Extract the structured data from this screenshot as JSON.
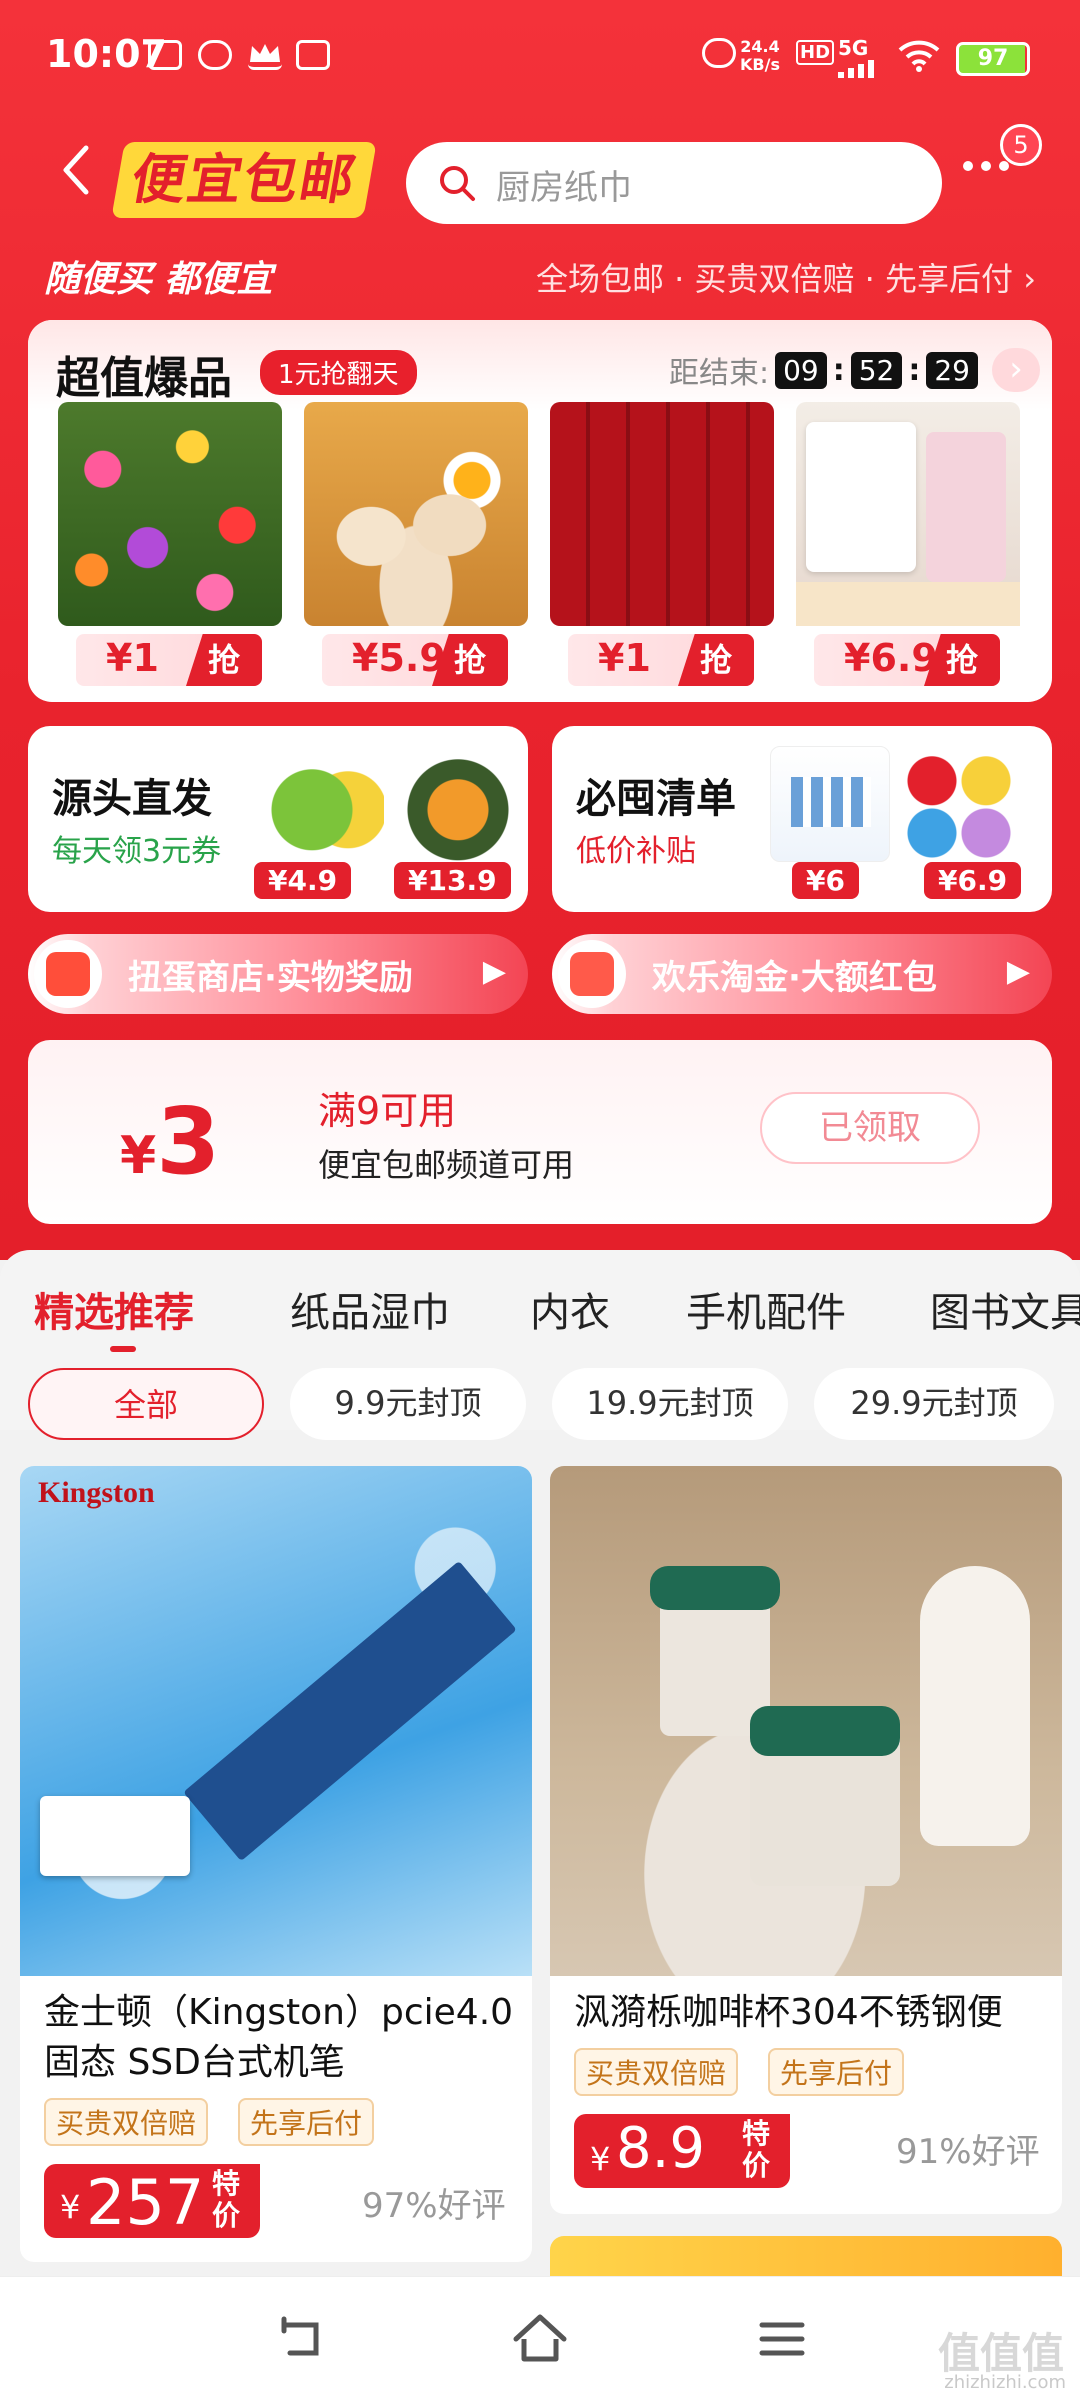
{
  "status": {
    "time": "10:07",
    "net_speed": "24.4",
    "net_unit": "KB/s",
    "hd": "HD",
    "signal": "5G",
    "battery": "97"
  },
  "header": {
    "brand": "便宜包邮",
    "search_placeholder": "厨房纸巾",
    "notif_count": "5"
  },
  "slogan": "随便买 都便宜",
  "benefits": "全场包邮 · 买贵双倍赔 · 先享后付",
  "hot": {
    "title": "超值爆品",
    "tag": "1元抢翻天",
    "countdown_label": "距结束:",
    "h": "09",
    "m": "52",
    "s": "29",
    "items": [
      {
        "price": "¥1",
        "btn": "抢"
      },
      {
        "price": "¥5.9",
        "btn": "抢"
      },
      {
        "price": "¥1",
        "btn": "抢"
      },
      {
        "price": "¥6.9",
        "btn": "抢"
      }
    ]
  },
  "promo": {
    "left": {
      "title": "源头直发",
      "sub": "每天领3元券",
      "price1": "¥4.9",
      "price2": "¥13.9"
    },
    "right": {
      "title": "必囤清单",
      "sub": "低价补贴",
      "price1": "¥6",
      "price2": "¥6.9"
    }
  },
  "banners": {
    "left": "扭蛋商店·实物奖励",
    "right": "欢乐淘金·大额红包"
  },
  "coupon": {
    "currency": "¥",
    "amount": "3",
    "cond": "满9可用",
    "desc": "便宜包邮频道可用",
    "state": "已领取"
  },
  "tabs": [
    "精选推荐",
    "纸品湿巾",
    "内衣",
    "手机配件",
    "图书文具"
  ],
  "chips": [
    "全部",
    "9.9元封顶",
    "19.9元封顶",
    "29.9元封顶"
  ],
  "products": [
    {
      "name": "金士顿（Kingston）pcie4.0固态 SSD台式机笔",
      "tag1": "买贵双倍赔",
      "tag2": "先享后付",
      "currency": "¥",
      "price": "257",
      "special": "特价",
      "rating": "97%好评",
      "img_brand": "Kingston"
    },
    {
      "name": "沨漪栎咖啡杯304不锈钢便",
      "tag1": "买贵双倍赔",
      "tag2": "先享后付",
      "currency": "¥",
      "price": "8.9",
      "special": "特价",
      "rating": "91%好评"
    }
  ],
  "watermark": {
    "main": "值值值",
    "sub": "zhizhizhi.com"
  }
}
